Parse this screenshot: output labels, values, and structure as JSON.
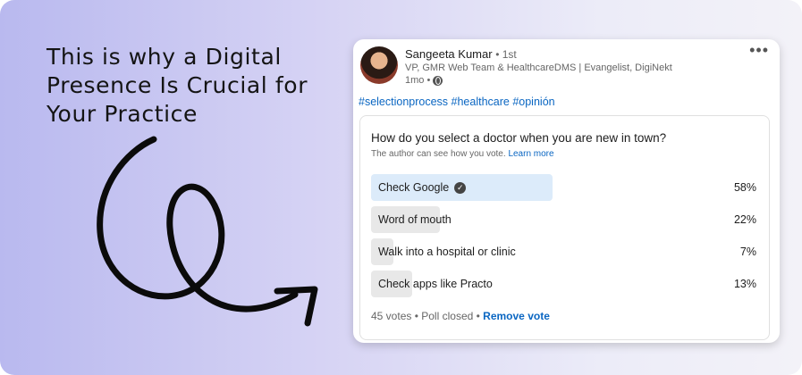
{
  "headline": {
    "lines": [
      "This is why a Digital",
      "Presence Is Crucial for",
      "Your Practice"
    ]
  },
  "post": {
    "author_name": "Sangeeta Kumar",
    "connection_degree": "• 1st",
    "author_title": "VP, GMR Web Team & HealthcareDMS | Evangelist, DigiNekt",
    "time_ago": "1mo •",
    "more_label": "•••",
    "hashtags": "#selectionprocess #healthcare #opinión"
  },
  "poll": {
    "question": "How do you select a doctor when you are new in town?",
    "visibility_note": "The author can see how you vote.",
    "learn_more": "Learn more",
    "options": [
      {
        "label": "Check Google",
        "percent_label": "58%",
        "percent": 58,
        "selected": true
      },
      {
        "label": "Word of mouth",
        "percent_label": "22%",
        "percent": 22,
        "selected": false
      },
      {
        "label": "Walk into a hospital or clinic",
        "percent_label": "7%",
        "percent": 7,
        "selected": false
      },
      {
        "label": "Check apps like Practo",
        "percent_label": "13%",
        "percent": 13,
        "selected": false
      }
    ],
    "votes": "45 votes",
    "status": "• Poll closed •",
    "remove_vote": "Remove vote"
  }
}
